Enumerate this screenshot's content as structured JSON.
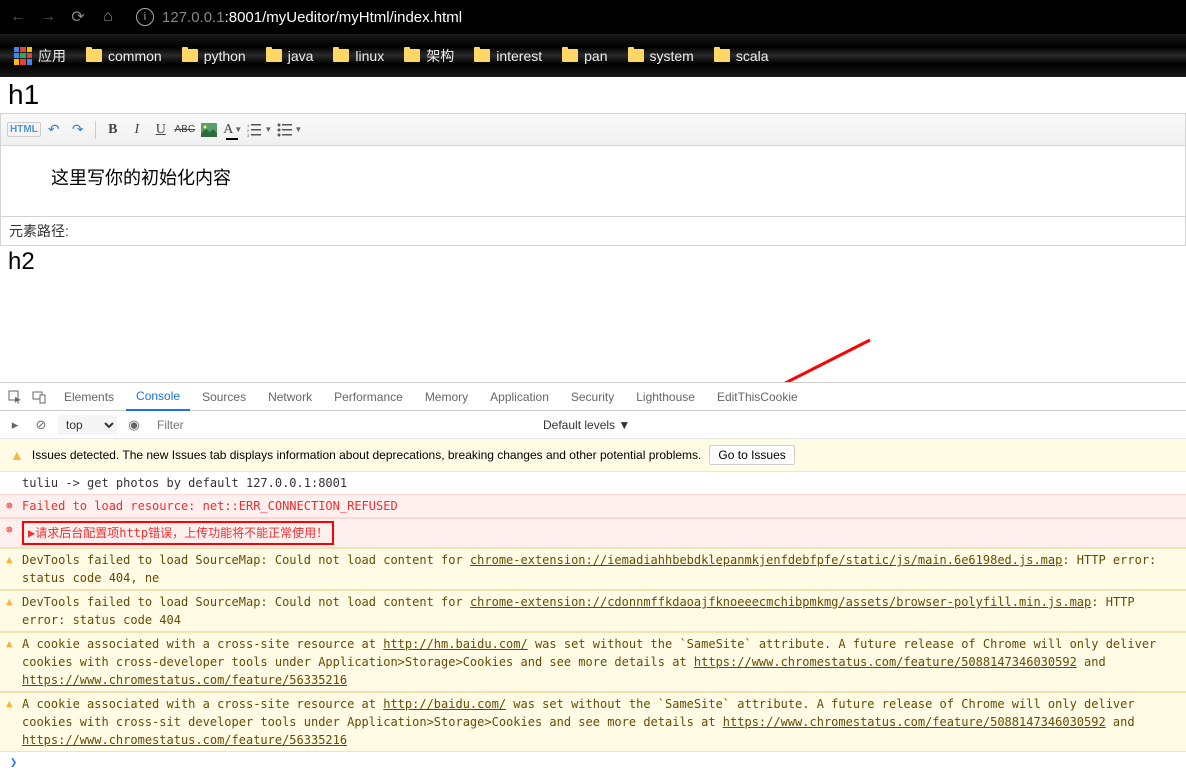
{
  "browser": {
    "url_gray_prefix": "127.0.0.1",
    "url_rest": ":8001/myUeditor/myHtml/index.html"
  },
  "bookmarks": {
    "apps_label": "应用",
    "items": [
      "common",
      "python",
      "java",
      "linux",
      "架构",
      "interest",
      "pan",
      "system",
      "scala"
    ]
  },
  "page": {
    "h1": "h1",
    "h2": "h2",
    "editor_content": "这里写你的初始化内容",
    "element_path_label": "元素路径:"
  },
  "toolbar": {
    "html": "HTML",
    "bold": "B",
    "italic": "I",
    "underline": "U",
    "strike": "ABC",
    "font": "A"
  },
  "devtools": {
    "tabs": [
      "Elements",
      "Console",
      "Sources",
      "Network",
      "Performance",
      "Memory",
      "Application",
      "Security",
      "Lighthouse",
      "EditThisCookie"
    ],
    "active_tab": "Console",
    "context_dropdown": "top",
    "filter_placeholder": "Filter",
    "levels_label": "Default levels ▼",
    "issues_text": "Issues detected. The new Issues tab displays information about deprecations, breaking changes and other potential problems.",
    "issues_button": "Go to Issues",
    "messages": [
      {
        "type": "log",
        "text": "tuliu -> get photos by default 127.0.0.1:8001"
      },
      {
        "type": "error",
        "text": "Failed to load resource: net::ERR_CONNECTION_REFUSED"
      },
      {
        "type": "error",
        "highlighted": true,
        "prefix": "▶",
        "text": "请求后台配置项http错误，上传功能将不能正常使用！"
      },
      {
        "type": "warning",
        "text_before": "DevTools failed to load SourceMap: Could not load content for ",
        "link": "chrome-extension://iemadiahhbebdklepanmkjenfdebfpfe/static/js/main.6e6198ed.js.map",
        "text_after": ": HTTP error: status code 404, ne"
      },
      {
        "type": "warning",
        "text_before": "DevTools failed to load SourceMap: Could not load content for ",
        "link": "chrome-extension://cdonnmffkdaoajfknoeeecmchibpmkmg/assets/browser-polyfill.min.js.map",
        "text_after": ": HTTP error: status code 404"
      },
      {
        "type": "warning",
        "text_before": "A cookie associated with a cross-site resource at ",
        "link": "http://hm.baidu.com/",
        "text_after": " was set without the `SameSite` attribute. A future release of Chrome will only deliver cookies with cross-developer tools under Application>Storage>Cookies and see more details at ",
        "link2": "https://www.chromestatus.com/feature/5088147346030592",
        "text_mid": " and ",
        "link3": "https://www.chromestatus.com/feature/56335216"
      },
      {
        "type": "warning",
        "text_before": "A cookie associated with a cross-site resource at ",
        "link": "http://baidu.com/",
        "text_after": " was set without the `SameSite` attribute. A future release of Chrome will only deliver cookies with cross-sit developer tools under Application>Storage>Cookies and see more details at ",
        "link2": "https://www.chromestatus.com/feature/5088147346030592",
        "text_mid": " and ",
        "link3": "https://www.chromestatus.com/feature/56335216"
      }
    ],
    "prompt": "❯"
  }
}
